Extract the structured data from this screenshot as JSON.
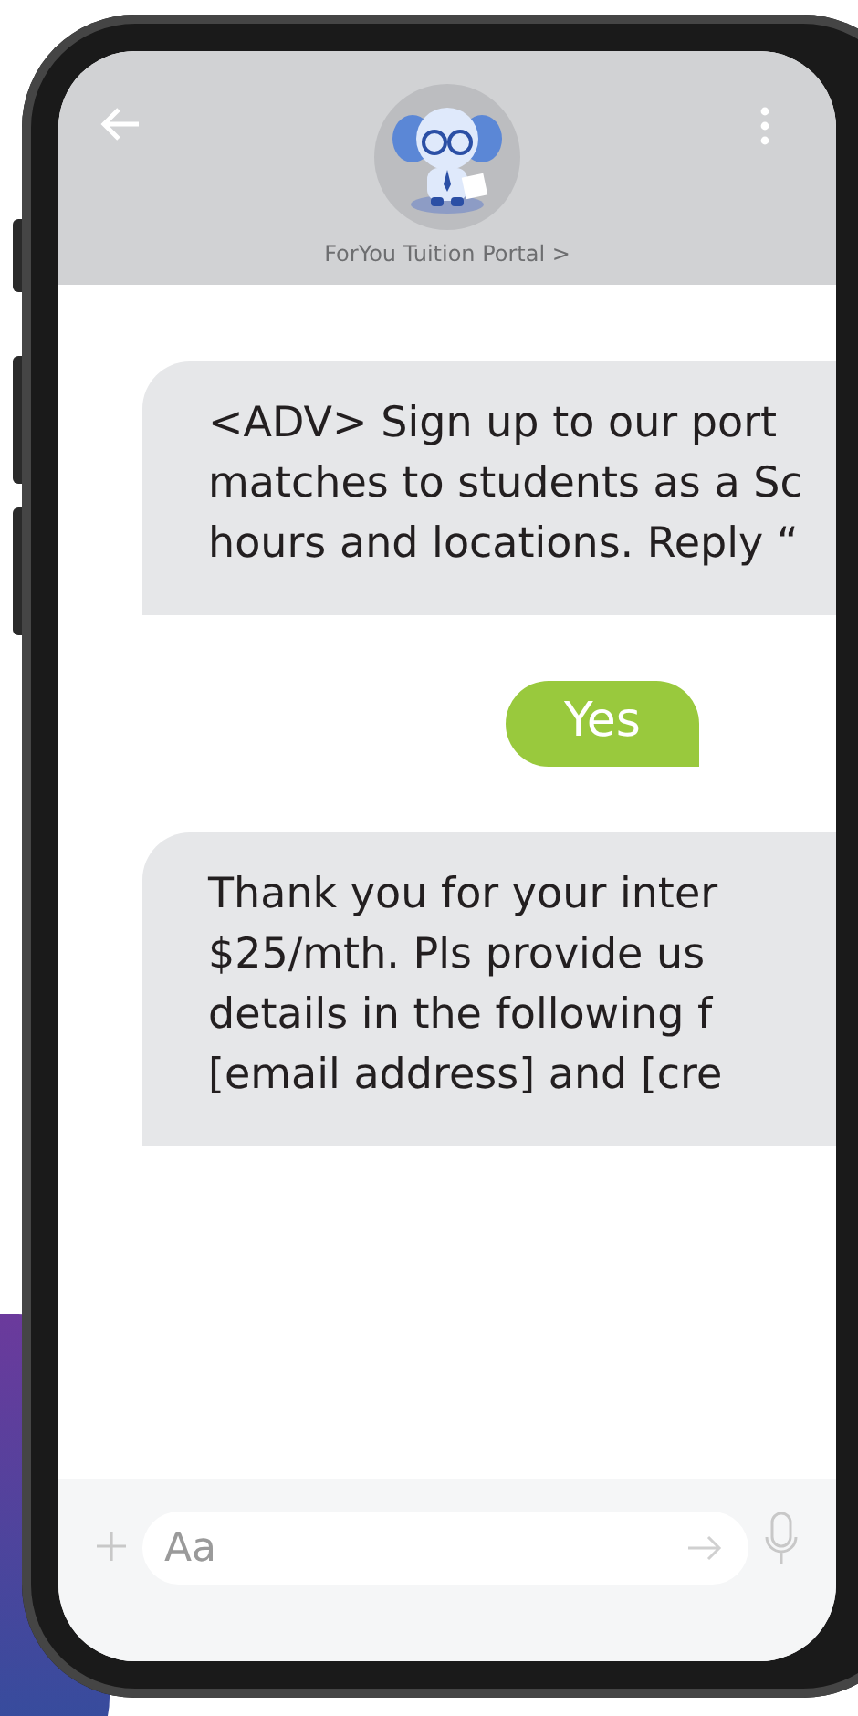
{
  "header": {
    "title": "ForYou Tuition Portal >"
  },
  "messages": [
    {
      "kind": "received",
      "lines": [
        "<ADV> Sign up to our port",
        "matches to students as a Sc",
        "hours and locations. Reply “"
      ]
    },
    {
      "kind": "sent",
      "lines": [
        "Yes"
      ]
    },
    {
      "kind": "received",
      "lines": [
        "Thank you for your inter",
        "$25/mth. Pls provide us",
        "details in the following f",
        "[email address] and [cre"
      ]
    }
  ],
  "composer": {
    "placeholder": "Aa"
  }
}
